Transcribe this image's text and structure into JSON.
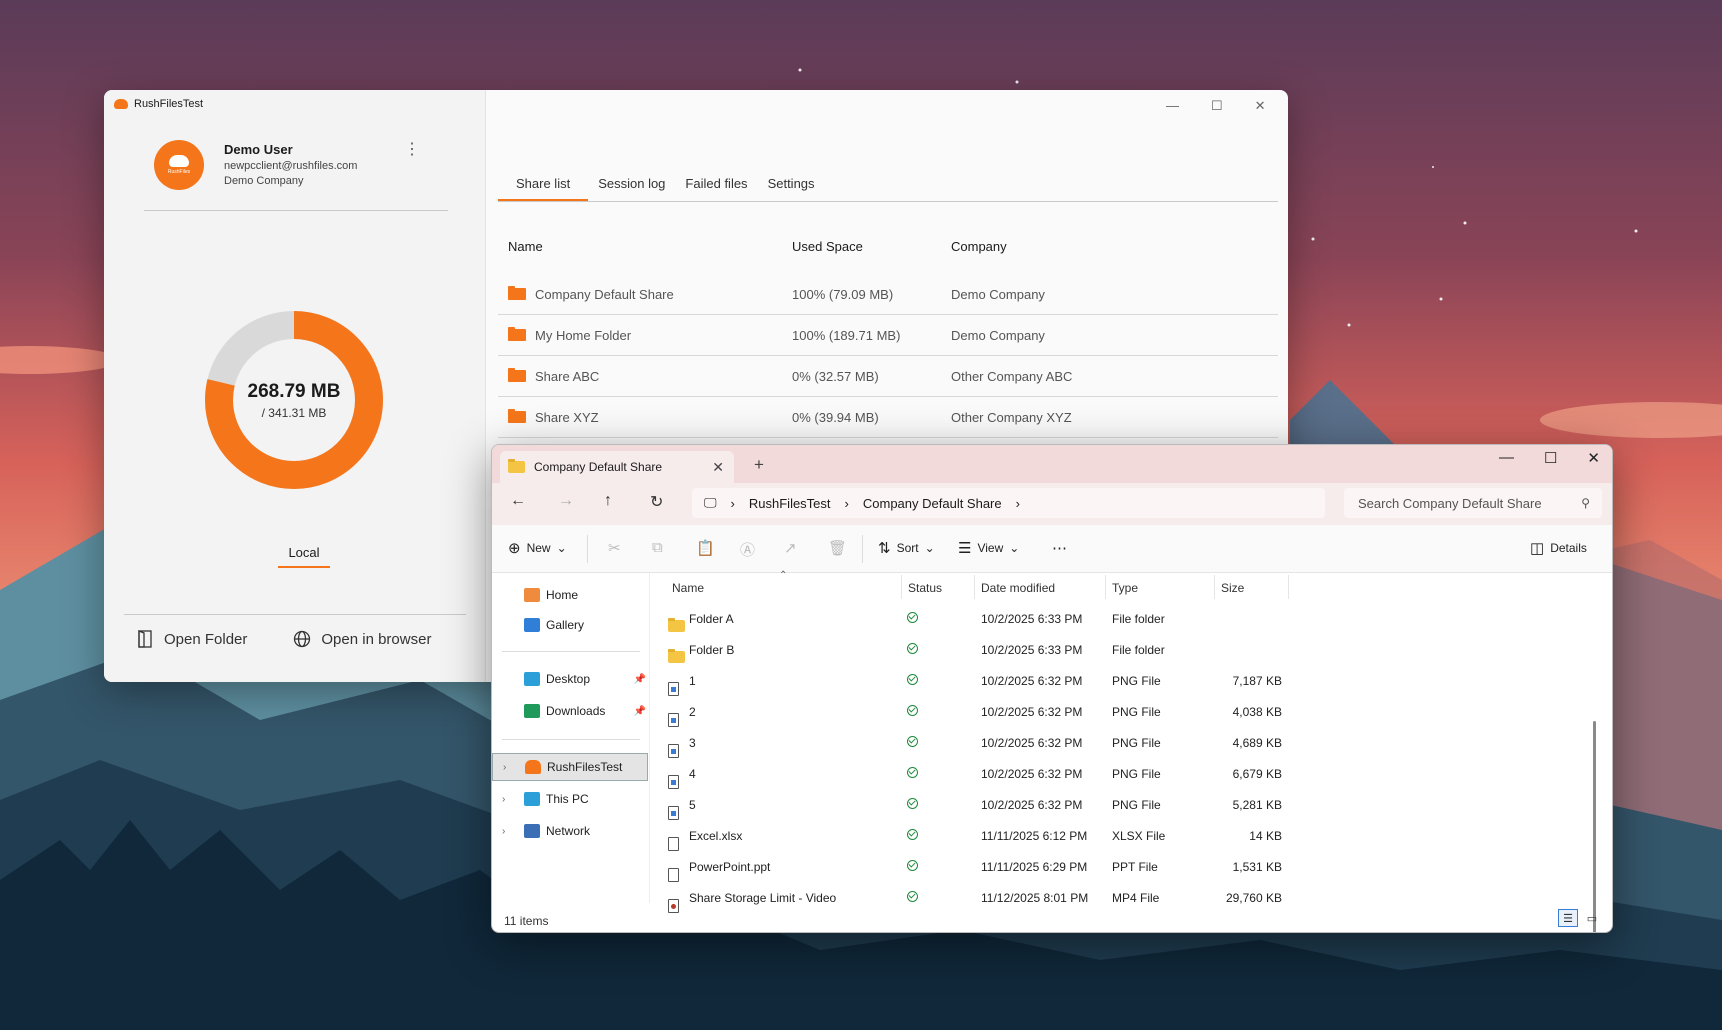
{
  "rushfiles": {
    "app_title": "RushFilesTest",
    "avatar_brand": "RushFiles",
    "user": {
      "name": "Demo User",
      "email": "newpcclient@rushfiles.com",
      "company": "Demo Company"
    },
    "storage": {
      "used": "268.79 MB",
      "total": "/ 341.31 MB",
      "used_fraction": 0.7875
    },
    "local_tab": "Local",
    "actions": {
      "open_folder": "Open Folder",
      "open_browser": "Open in browser"
    },
    "tabs": [
      "Share list",
      "Session log",
      "Failed files",
      "Settings"
    ],
    "active_tab": "Share list",
    "columns": {
      "name": "Name",
      "used_space": "Used Space",
      "company": "Company"
    },
    "shares": [
      {
        "name": "Company Default Share",
        "used_space": "100% (79.09 MB)",
        "company": "Demo Company"
      },
      {
        "name": "My Home Folder",
        "used_space": "100% (189.71 MB)",
        "company": "Demo Company"
      },
      {
        "name": "Share ABC",
        "used_space": "0% (32.57 MB)",
        "company": "Other Company ABC"
      },
      {
        "name": "Share XYZ",
        "used_space": "0% (39.94 MB)",
        "company": "Other Company XYZ"
      }
    ],
    "accent_color": "#f5761a"
  },
  "explorer": {
    "tab_title": "Company Default Share",
    "breadcrumb": [
      "RushFilesTest",
      "Company Default Share"
    ],
    "search_placeholder": "Search Company Default Share",
    "commands": {
      "new": "New",
      "sort": "Sort",
      "view": "View",
      "details": "Details"
    },
    "sidebar": {
      "home": "Home",
      "gallery": "Gallery",
      "desktop": "Desktop",
      "downloads": "Downloads",
      "rushfiles": "RushFilesTest",
      "this_pc": "This PC",
      "network": "Network"
    },
    "columns": {
      "name": "Name",
      "status": "Status",
      "date": "Date modified",
      "type": "Type",
      "size": "Size"
    },
    "files": [
      {
        "name": "Folder A",
        "date": "10/2/2025 6:33 PM",
        "type": "File folder",
        "size": "",
        "icon": "folder-icon"
      },
      {
        "name": "Folder B",
        "date": "10/2/2025 6:33 PM",
        "type": "File folder",
        "size": "",
        "icon": "folder-icon"
      },
      {
        "name": "1",
        "date": "10/2/2025 6:32 PM",
        "type": "PNG File",
        "size": "7,187 KB",
        "icon": "png-file-icon"
      },
      {
        "name": "2",
        "date": "10/2/2025 6:32 PM",
        "type": "PNG File",
        "size": "4,038 KB",
        "icon": "png-file-icon"
      },
      {
        "name": "3",
        "date": "10/2/2025 6:32 PM",
        "type": "PNG File",
        "size": "4,689 KB",
        "icon": "png-file-icon"
      },
      {
        "name": "4",
        "date": "10/2/2025 6:32 PM",
        "type": "PNG File",
        "size": "6,679 KB",
        "icon": "png-file-icon"
      },
      {
        "name": "5",
        "date": "10/2/2025 6:32 PM",
        "type": "PNG File",
        "size": "5,281 KB",
        "icon": "png-file-icon"
      },
      {
        "name": "Excel.xlsx",
        "date": "11/11/2025 6:12 PM",
        "type": "XLSX File",
        "size": "14 KB",
        "icon": "file-icon"
      },
      {
        "name": "PowerPoint.ppt",
        "date": "11/11/2025 6:29 PM",
        "type": "PPT File",
        "size": "1,531 KB",
        "icon": "file-icon"
      },
      {
        "name": "Share Storage Limit - Video",
        "date": "11/12/2025 8:01 PM",
        "type": "MP4 File",
        "size": "29,760 KB",
        "icon": "video-file-icon"
      }
    ],
    "status_text": "11 items"
  }
}
